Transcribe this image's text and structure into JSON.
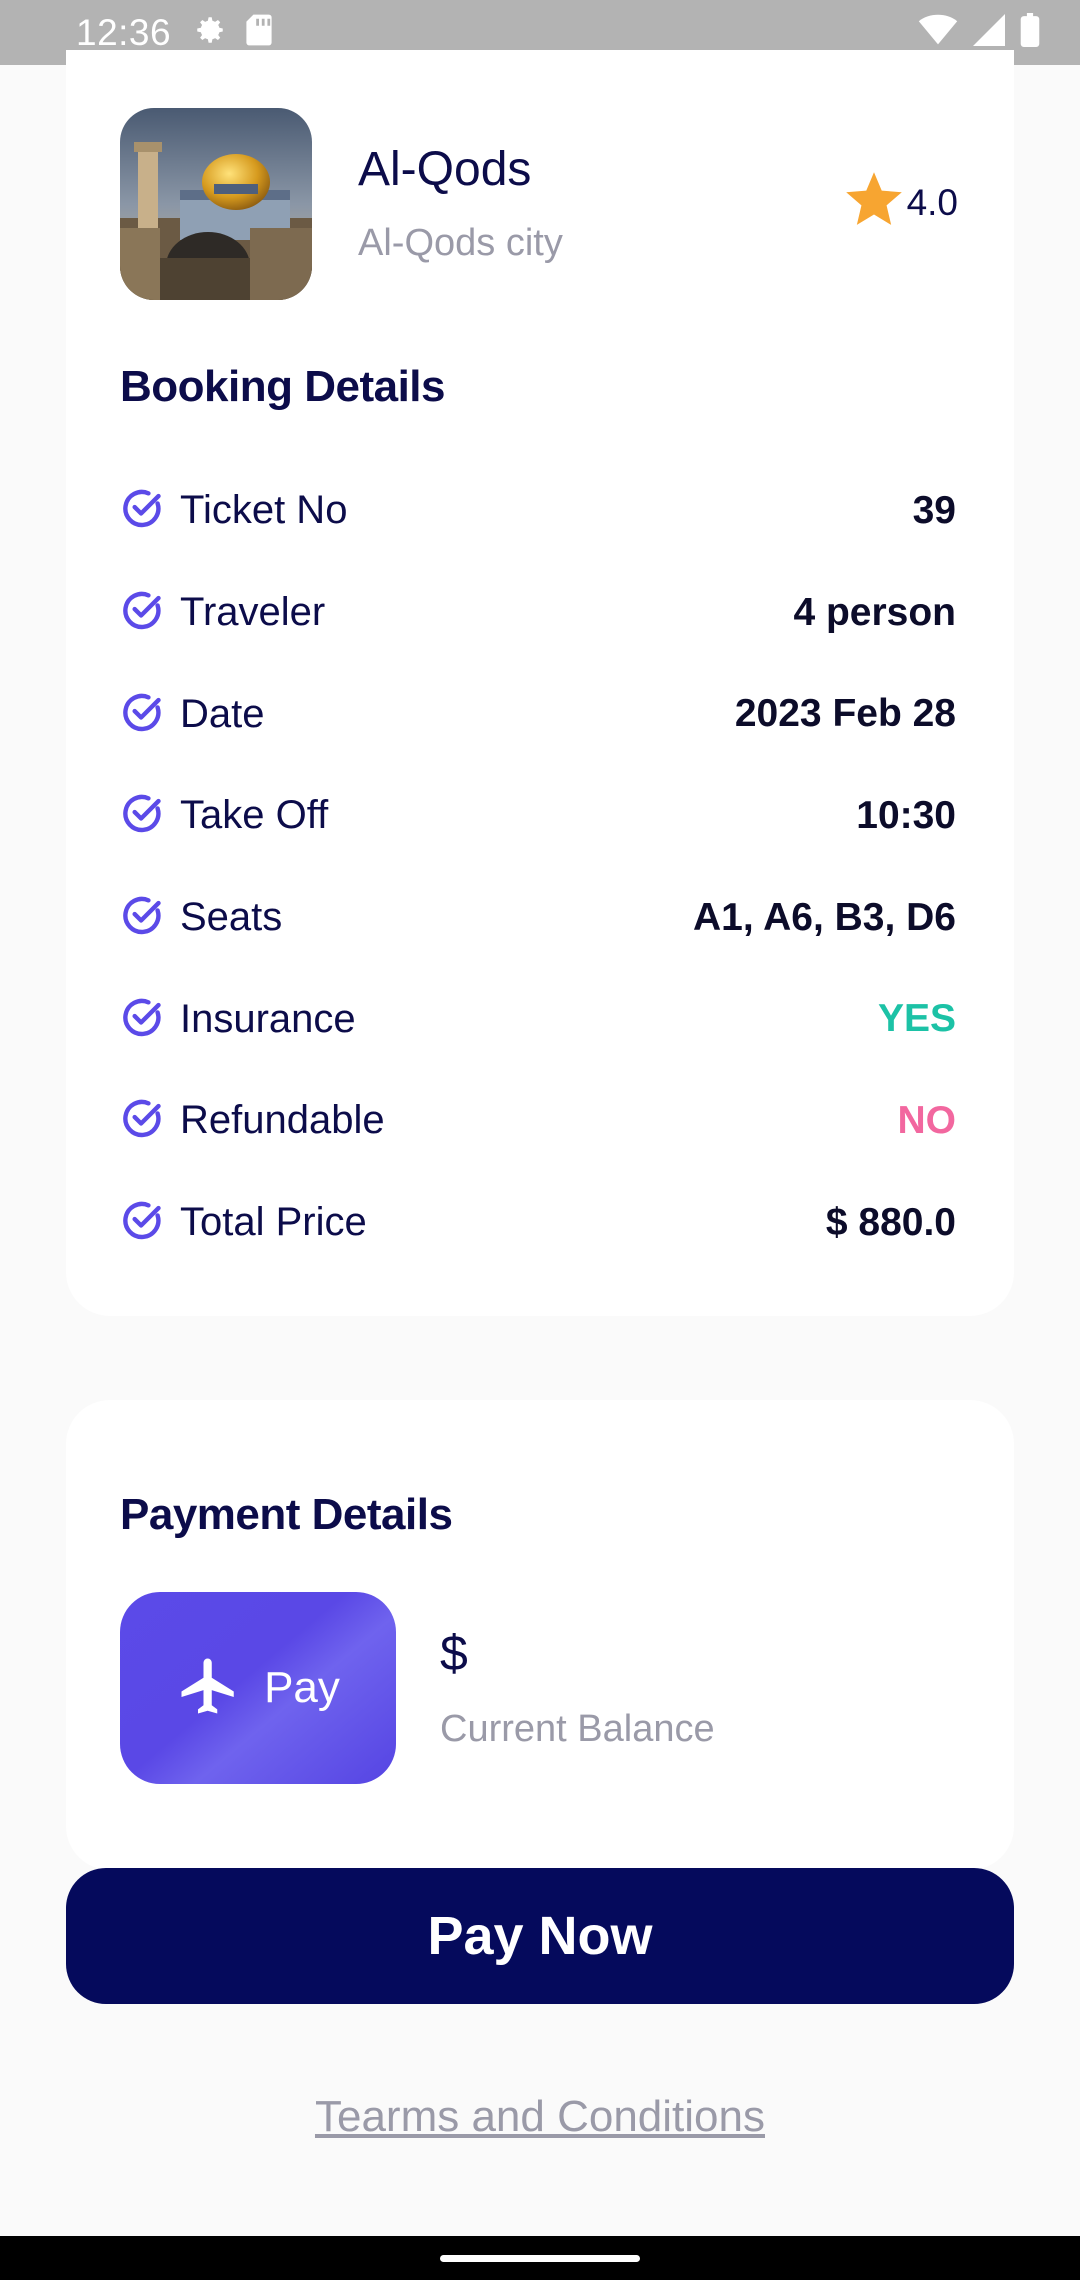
{
  "status_bar": {
    "time": "12:36",
    "icons_left": [
      "gear-icon",
      "sd-card-icon"
    ],
    "icons_right": [
      "wifi-icon",
      "signal-icon",
      "battery-icon"
    ]
  },
  "place": {
    "name": "Al-Qods",
    "city": "Al-Qods city",
    "rating": "4.0"
  },
  "booking": {
    "title": "Booking Details",
    "rows": [
      {
        "label": "Ticket No",
        "value": "39"
      },
      {
        "label": "Traveler",
        "value": "4 person"
      },
      {
        "label": "Date",
        "value": "2023 Feb 28"
      },
      {
        "label": "Take Off",
        "value": "10:30"
      },
      {
        "label": "Seats",
        "value": "A1, A6, B3, D6"
      },
      {
        "label": "Insurance",
        "value": "YES"
      },
      {
        "label": "Refundable",
        "value": "NO"
      },
      {
        "label": "Total Price",
        "value": "$ 880.0"
      }
    ]
  },
  "payment": {
    "title": "Payment Details",
    "tile_label": "Pay",
    "balance_amount": "$",
    "balance_label": "Current Balance"
  },
  "actions": {
    "pay_now": "Pay Now",
    "terms": "Tearms and Conditions"
  },
  "colors": {
    "accent": "#5b4ae8",
    "navy": "#050a5c",
    "yes": "#1cc2a6",
    "no": "#f2679f",
    "star": "#f7a531"
  }
}
